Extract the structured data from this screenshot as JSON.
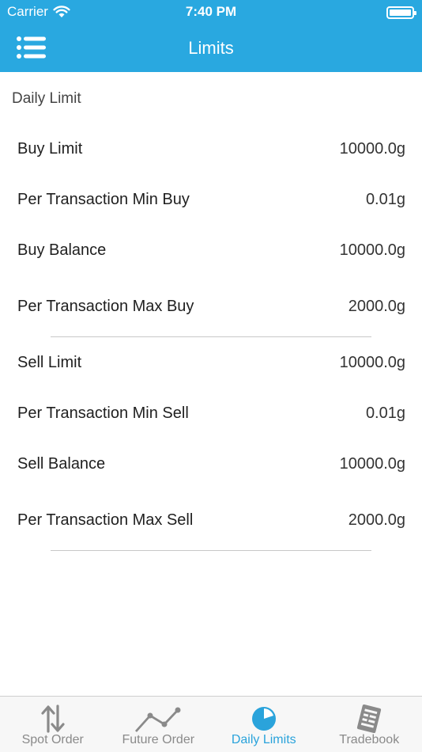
{
  "status_bar": {
    "carrier": "Carrier",
    "time": "7:40 PM"
  },
  "nav": {
    "title": "Limits"
  },
  "section": {
    "title": "Daily Limit"
  },
  "buy_limits": [
    {
      "label": "Buy Limit",
      "value": "10000.0g"
    },
    {
      "label": "Per Transaction Min Buy",
      "value": "0.01g"
    },
    {
      "label": "Buy Balance",
      "value": "10000.0g"
    },
    {
      "label": "Per Transaction Max Buy",
      "value": "2000.0g"
    }
  ],
  "sell_limits": [
    {
      "label": "Sell Limit",
      "value": "10000.0g"
    },
    {
      "label": "Per Transaction Min Sell",
      "value": "0.01g"
    },
    {
      "label": "Sell Balance",
      "value": "10000.0g"
    },
    {
      "label": "Per Transaction Max Sell",
      "value": "2000.0g"
    }
  ],
  "tabbar": {
    "tabs": [
      {
        "label": "Spot Order",
        "icon": "up-down-arrows-icon"
      },
      {
        "label": "Future Order",
        "icon": "line-chart-icon"
      },
      {
        "label": "Daily Limits",
        "icon": "pie-chart-icon",
        "active": true
      },
      {
        "label": "Tradebook",
        "icon": "document-icon"
      }
    ]
  },
  "colors": {
    "header": "#29a8e0",
    "active_tab": "#2aa3db",
    "inactive_tab": "#8a8a8a"
  }
}
